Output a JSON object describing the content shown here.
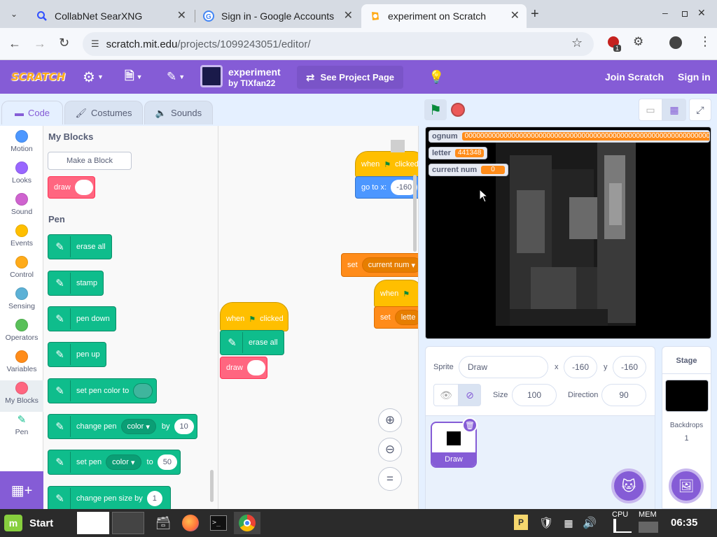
{
  "browser": {
    "tabs": [
      {
        "title": "CollabNet SearXNG",
        "active": false
      },
      {
        "title": "Sign in - Google Accounts",
        "active": false
      },
      {
        "title": "experiment on Scratch",
        "active": true
      }
    ],
    "url_host": "scratch.mit.edu",
    "url_path": "/projects/1099243051/editor/",
    "extension_badge": "1"
  },
  "menubar": {
    "logo": "SCRATCH",
    "project_title": "experiment",
    "author": "by TIXfan22",
    "see_project": "See Project Page",
    "join": "Join Scratch",
    "signin": "Sign in"
  },
  "editor_tabs": {
    "code": "Code",
    "costumes": "Costumes",
    "sounds": "Sounds"
  },
  "categories": [
    {
      "label": "Motion",
      "color": "#4c97ff"
    },
    {
      "label": "Looks",
      "color": "#9966ff"
    },
    {
      "label": "Sound",
      "color": "#cf63cf"
    },
    {
      "label": "Events",
      "color": "#ffbf00"
    },
    {
      "label": "Control",
      "color": "#ffab19"
    },
    {
      "label": "Sensing",
      "color": "#5cb1d6"
    },
    {
      "label": "Operators",
      "color": "#59c059"
    },
    {
      "label": "Variables",
      "color": "#ff8c1a"
    },
    {
      "label": "My Blocks",
      "color": "#ff6680"
    },
    {
      "label": "Pen",
      "color": "#0fbd8c"
    }
  ],
  "palette": {
    "myblocks_heading": "My Blocks",
    "make_block": "Make a Block",
    "draw_block": "draw",
    "pen_heading": "Pen",
    "erase_all": "erase all",
    "stamp": "stamp",
    "pen_down": "pen down",
    "pen_up": "pen up",
    "set_pen_color": "set pen color to",
    "change_pen": "change pen",
    "change_pen_dd": "color",
    "change_pen_by": "by",
    "change_pen_val": "10",
    "set_pen": "set pen",
    "set_pen_dd": "color",
    "set_pen_to": "to",
    "set_pen_val": "50",
    "change_size": "change pen size by",
    "change_size_val": "1"
  },
  "script": {
    "when_label": "when",
    "clicked_label": "clicked",
    "goto_label": "go to x:",
    "goto_val": "-160",
    "set_label": "set",
    "set_dd": "current num",
    "set2_label": "set",
    "set2_dd": "lette",
    "erase": "erase all",
    "draw": "draw"
  },
  "stage": {
    "monitors": [
      {
        "name": "ognum",
        "value": "0000000000000000000000000000000000000000000000000000000000000000000000"
      },
      {
        "name": "letter",
        "value": "441348"
      },
      {
        "name": "current num",
        "value": "0"
      }
    ]
  },
  "sprite_info": {
    "sprite_label": "Sprite",
    "sprite_name": "Draw",
    "x_label": "x",
    "x_val": "-160",
    "y_label": "y",
    "y_val": "-160",
    "size_label": "Size",
    "size_val": "100",
    "dir_label": "Direction",
    "dir_val": "90",
    "thumb_name": "Draw"
  },
  "stage_info": {
    "title": "Stage",
    "backdrops_label": "Backdrops",
    "backdrops_count": "1"
  },
  "taskbar": {
    "start": "Start",
    "clock": "06:35",
    "cpu": "CPU",
    "mem": "MEM"
  }
}
